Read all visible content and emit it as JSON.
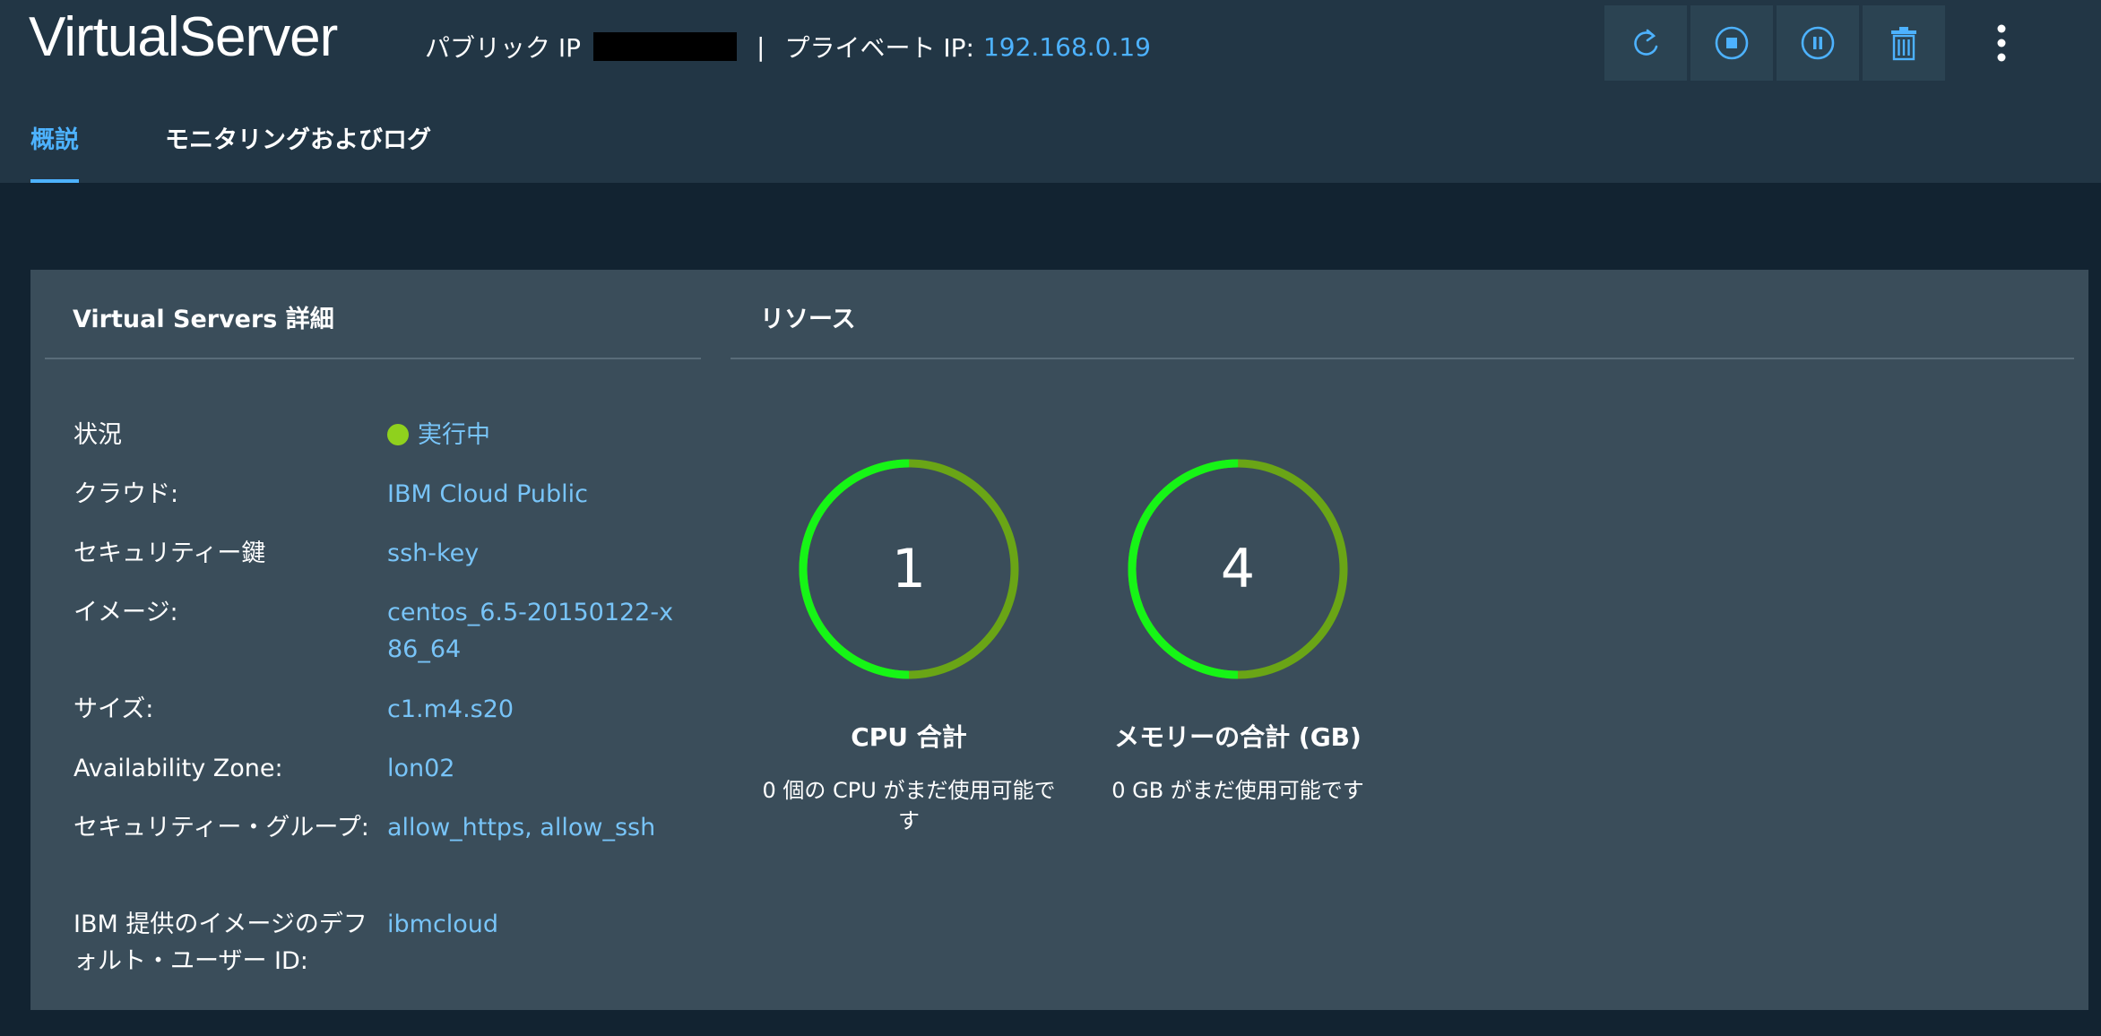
{
  "header": {
    "title": "VirtualServer",
    "public_ip_label": "パブリック IP",
    "separator": "|",
    "private_ip_label": "プライベート IP:",
    "private_ip_value": "192.168.0.19"
  },
  "toolbar": {
    "icons": [
      "restart-icon",
      "stop-icon",
      "pause-icon",
      "trash-icon"
    ],
    "overflow_icon": "overflow-menu-icon",
    "icon_color": "#4db2ff"
  },
  "tabs": [
    {
      "label": "概説",
      "active": true
    },
    {
      "label": "モニタリングおよびログ",
      "active": false
    }
  ],
  "details": {
    "title": "Virtual Servers 詳細",
    "rows": [
      {
        "label": "状況",
        "value": "実行中"
      },
      {
        "label": "クラウド:",
        "value": "IBM Cloud Public"
      },
      {
        "label": "セキュリティー鍵",
        "value": "ssh-key"
      },
      {
        "label": "イメージ:",
        "value": "centos_6.5-20150122-x86_64"
      },
      {
        "label": "サイズ:",
        "value": "c1.m4.s20"
      },
      {
        "label": "Availability Zone:",
        "value": "lon02"
      },
      {
        "label": "セキュリティー・グループ:",
        "value": "allow_https, allow_ssh"
      },
      {
        "label": "IBM 提供のイメージのデフォルト・ユーザー ID:",
        "value": "ibmcloud"
      }
    ]
  },
  "resources": {
    "title": "リソース",
    "gauges": [
      {
        "value": "1",
        "label": "CPU 合計",
        "sub": "0 個の CPU がまだ使用可能です",
        "used_fraction": 0.5
      },
      {
        "value": "4",
        "label": "メモリーの合計 (GB)",
        "sub": "0 GB がまだ使用可能です",
        "used_fraction": 0.5
      }
    ]
  },
  "colors": {
    "accent": "#4db2ff",
    "link": "#78c4f8",
    "status_running": "#8fd11d",
    "gauge_bright": "#16f516",
    "gauge_dark": "#6aa516"
  }
}
